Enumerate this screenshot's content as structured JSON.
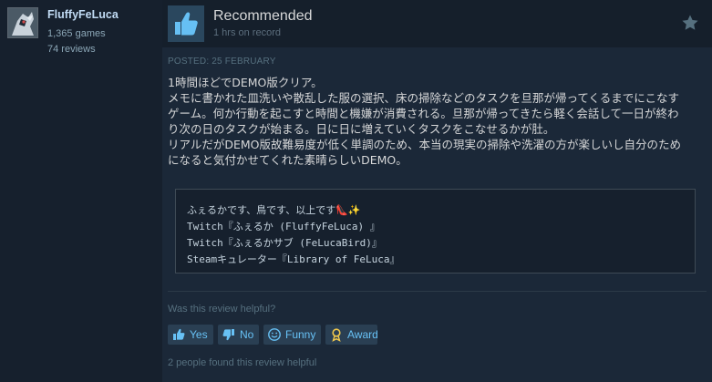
{
  "author": {
    "username": "FluffyFeLuca",
    "games": "1,365 games",
    "reviews": "74 reviews"
  },
  "review": {
    "verdict": "Recommended",
    "hours": "1 hrs on record",
    "posted": "POSTED: 25 FEBRUARY",
    "body_lines": [
      "1時間ほどでDEMO版クリア。",
      "メモに書かれた皿洗いや散乱した服の選択、床の掃除などのタスクを旦那が帰ってくるまでにこなす",
      "ゲーム。何か行動を起こすと時間と機嫌が消費される。旦那が帰ってきたら軽く会話して一日が終わ",
      "り次の日のタスクが始まる。日に日に増えていくタスクをこなせるかが肚。",
      "リアルだがDEMO版故難易度が低く単調のため、本当の現実の掃除や洗濯の方が楽しいし自分のため",
      "になると気付かせてくれた素晴らしいDEMO。"
    ],
    "code_lines": [
      "ふぇるかです、鳥です、以上です👠✨",
      "  Twitch『ふぇるか (FluffyFeLuca) 』",
      "  Twitch『ふぇるかサブ (FeLucaBird)』",
      "  Steamキュレーター『Library of FeLuca』"
    ]
  },
  "helpful": {
    "question": "Was this review helpful?",
    "buttons": {
      "yes": "Yes",
      "no": "No",
      "funny": "Funny",
      "award": "Award"
    },
    "found_text": "2 people found this review helpful"
  },
  "icons": {
    "thumb": "thumbs-up-icon",
    "star": "star-icon",
    "yes": "thumbs-up-icon",
    "no": "thumbs-down-icon",
    "funny": "smiley-icon",
    "award": "award-icon"
  },
  "colors": {
    "background": "#1b2838",
    "link_blue": "#67c1f5",
    "thumb_bg": "#2a475e",
    "thumb_fg": "#66c0f4"
  }
}
